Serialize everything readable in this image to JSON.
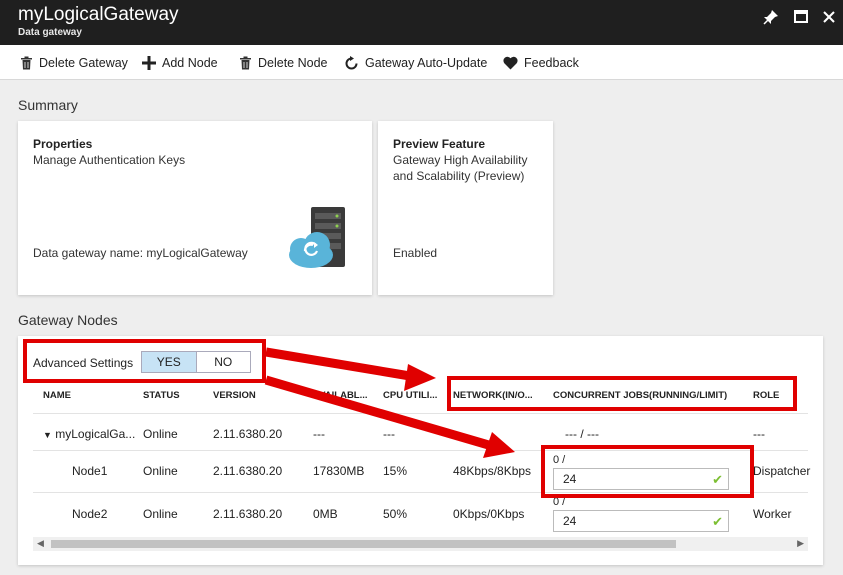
{
  "titlebar": {
    "title": "myLogicalGateway",
    "subtitle": "Data gateway"
  },
  "toolbar": {
    "delete_gateway": "Delete Gateway",
    "add_node": "Add Node",
    "delete_node": "Delete Node",
    "auto_update": "Gateway Auto-Update",
    "feedback": "Feedback"
  },
  "summary": {
    "label": "Summary",
    "properties": {
      "title": "Properties",
      "subtitle": "Manage Authentication Keys",
      "gateway_name": "Data gateway name: myLogicalGateway"
    },
    "preview": {
      "title": "Preview Feature",
      "line1": "Gateway High Availability",
      "line2": "and Scalability (Preview)",
      "status": "Enabled"
    }
  },
  "nodes": {
    "label": "Gateway Nodes",
    "advanced_settings": "Advanced Settings",
    "toggle_yes": "YES",
    "toggle_no": "NO",
    "headers": {
      "name": "NAME",
      "status": "STATUS",
      "version": "VERSION",
      "available": "AVAILABL...",
      "cpu": "CPU UTILI...",
      "network": "NETWORK(IN/O...",
      "jobs": "CONCURRENT JOBS(RUNNING/LIMIT)",
      "role": "ROLE"
    },
    "group_row": {
      "name": "myLogicalGa...",
      "status": "Online",
      "version": "2.11.6380.20",
      "available": "---",
      "cpu": "---",
      "network": "---",
      "jobs": "--- / ---",
      "role": "---"
    },
    "rows": [
      {
        "name": "Node1",
        "status": "Online",
        "version": "2.11.6380.20",
        "available": "17830MB",
        "cpu": "15%",
        "network": "48Kbps/8Kbps",
        "jobs_running": "0 /",
        "jobs_limit": "24",
        "role": "Dispatcher"
      },
      {
        "name": "Node2",
        "status": "Online",
        "version": "2.11.6380.20",
        "available": "0MB",
        "cpu": "50%",
        "network": "0Kbps/0Kbps",
        "jobs_running": "0 /",
        "jobs_limit": "24",
        "role": "Worker"
      }
    ]
  },
  "colors": {
    "titlebar": "#1f1f1f",
    "toggle_selected": "#c7e3f5",
    "annotation_red": "#e00000",
    "check_green": "#7cbf32"
  }
}
